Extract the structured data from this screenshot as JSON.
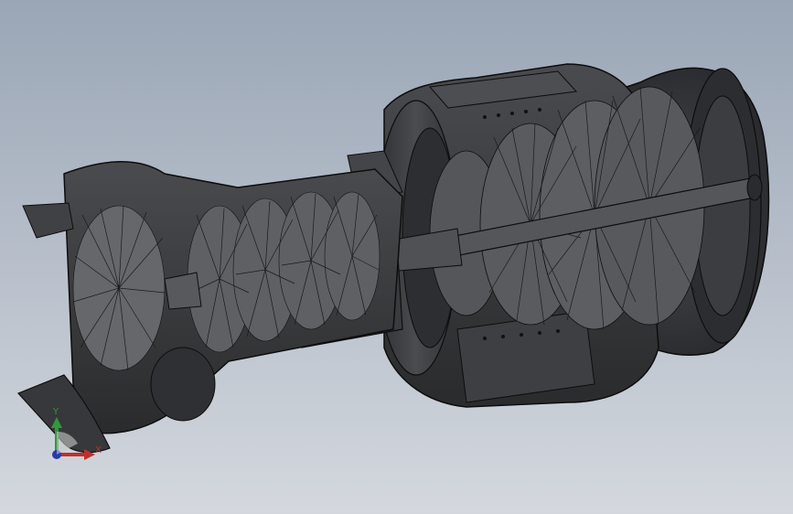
{
  "viewport": {
    "background_top": "#9aa6b6",
    "background_bottom": "#d4d8de",
    "model_color": "#3b3c3e",
    "edge_color": "#0d0d0d"
  },
  "triad": {
    "x_label": "X",
    "y_label": "Y",
    "x_color": "#c0302a",
    "y_color": "#2f9a3a",
    "z_color": "#2a3aa8"
  }
}
